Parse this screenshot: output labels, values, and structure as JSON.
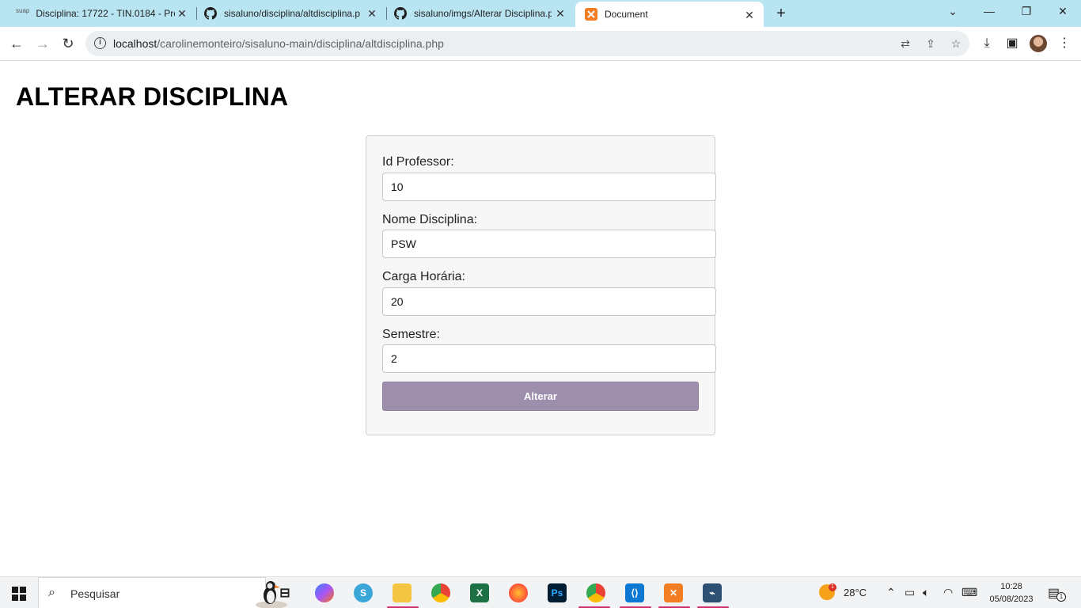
{
  "browser": {
    "tabs": [
      {
        "favicon": "suap",
        "title": "Disciplina: 17722 - TIN.0184 - Pro"
      },
      {
        "favicon": "github-icon",
        "title": "sisaluno/disciplina/altdisciplina.p"
      },
      {
        "favicon": "github-icon",
        "title": "sisaluno/imgs/Alterar Disciplina.p"
      },
      {
        "favicon": "xampp-icon",
        "title": "Document"
      }
    ],
    "url_host": "localhost",
    "url_path": "/carolinemonteiro/sisaluno-main/disciplina/altdisciplina.php"
  },
  "page": {
    "title": "ALTERAR DISCIPLINA",
    "fields": [
      {
        "label": "Id Professor:",
        "value": "10"
      },
      {
        "label": "Nome Disciplina:",
        "value": "PSW"
      },
      {
        "label": "Carga Horária:",
        "value": "20"
      },
      {
        "label": "Semestre:",
        "value": "2"
      }
    ],
    "submit_label": "Alterar",
    "button_color": "#9d8fab"
  },
  "taskbar": {
    "search_placeholder": "Pesquisar",
    "weather_temp": "28°C",
    "weather_badge": "1",
    "time": "10:28",
    "date": "05/08/2023",
    "notification_count": "1"
  }
}
